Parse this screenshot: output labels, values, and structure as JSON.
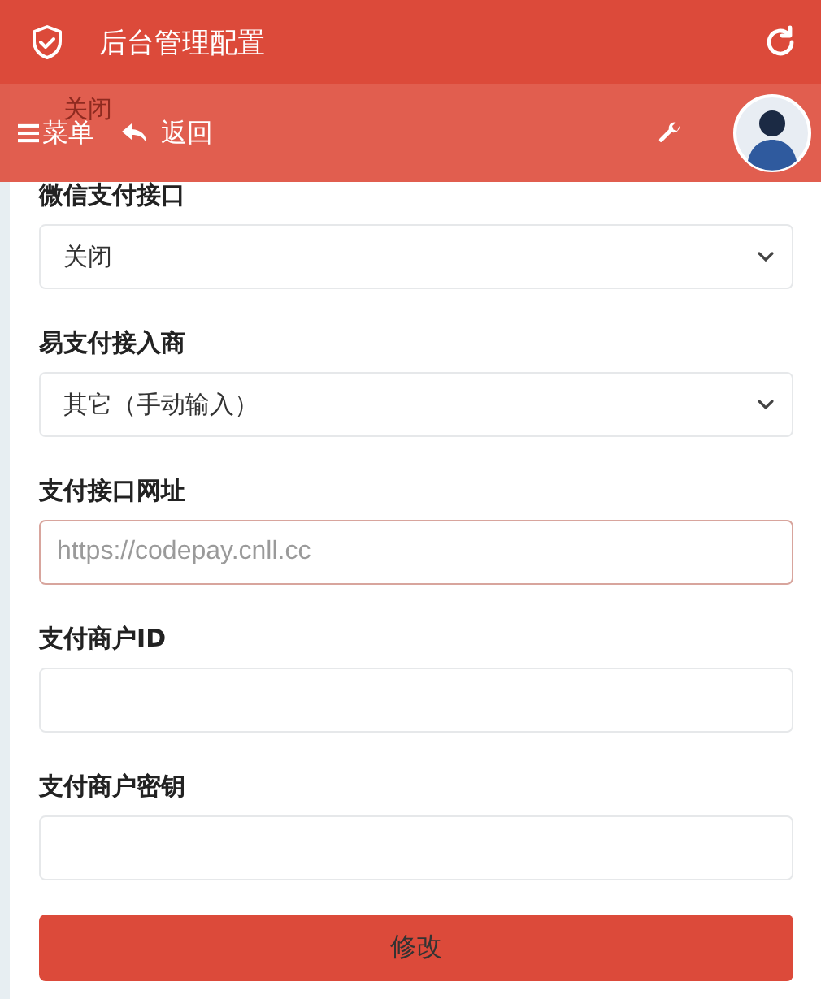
{
  "header": {
    "title": "后台管理配置"
  },
  "toolbar": {
    "menu": "菜单",
    "back": "返回"
  },
  "fields": [
    {
      "kind": "covered",
      "value": "关闭"
    },
    {
      "kind": "select",
      "label": "微信支付接口",
      "value": "关闭",
      "focused": false
    },
    {
      "kind": "select",
      "label": "易支付接入商",
      "value": "其它（手动输入）",
      "focused": false
    },
    {
      "kind": "input",
      "label": "支付接口网址",
      "placeholder": "https://codepay.cnll.cc",
      "focused": true
    },
    {
      "kind": "input",
      "label": "支付商户ID",
      "focused": false
    },
    {
      "kind": "input",
      "label": "支付商户密钥",
      "focused": false
    }
  ],
  "submit": "修改"
}
